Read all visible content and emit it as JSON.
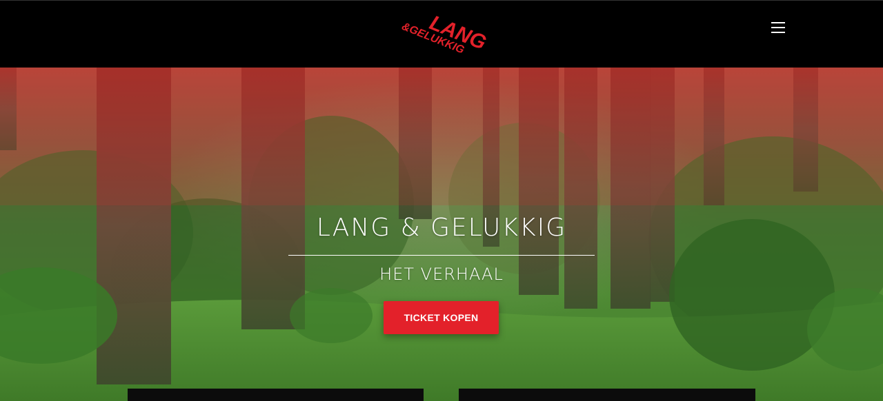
{
  "header": {
    "logo": {
      "line1": "LANG",
      "line2": "&GELUKKIG",
      "color": "#e3212a"
    },
    "menu_icon": "hamburger-menu-icon"
  },
  "hero": {
    "title": "LANG & GELUKKIG",
    "subtitle": "HET VERHAAL",
    "cta_label": "TICKET KOPEN",
    "cta_color": "#e3212a"
  },
  "colors": {
    "header_bg": "#000000",
    "accent": "#e3212a",
    "text": "#ffffff"
  }
}
